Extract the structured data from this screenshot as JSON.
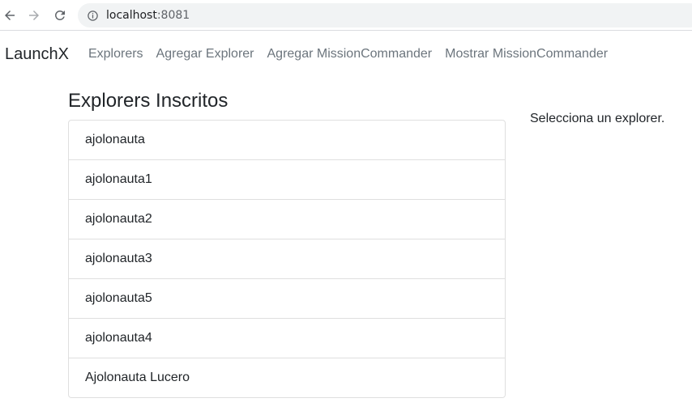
{
  "browser": {
    "url_host": "localhost",
    "url_port": ":8081"
  },
  "navbar": {
    "brand": "LaunchX",
    "links": [
      "Explorers",
      "Agregar Explorer",
      "Agregar MissionCommander",
      "Mostrar MissionCommander"
    ]
  },
  "main": {
    "title": "Explorers Inscritos",
    "explorers": [
      "ajolonauta",
      "ajolonauta1",
      "ajolonauta2",
      "ajolonauta3",
      "ajolonauta5",
      "ajolonauta4",
      "Ajolonauta Lucero"
    ],
    "side_message": "Selecciona un explorer."
  },
  "icons": {
    "back": "arrow-left-icon",
    "forward": "arrow-right-icon",
    "reload": "reload-icon",
    "info": "info-icon"
  }
}
